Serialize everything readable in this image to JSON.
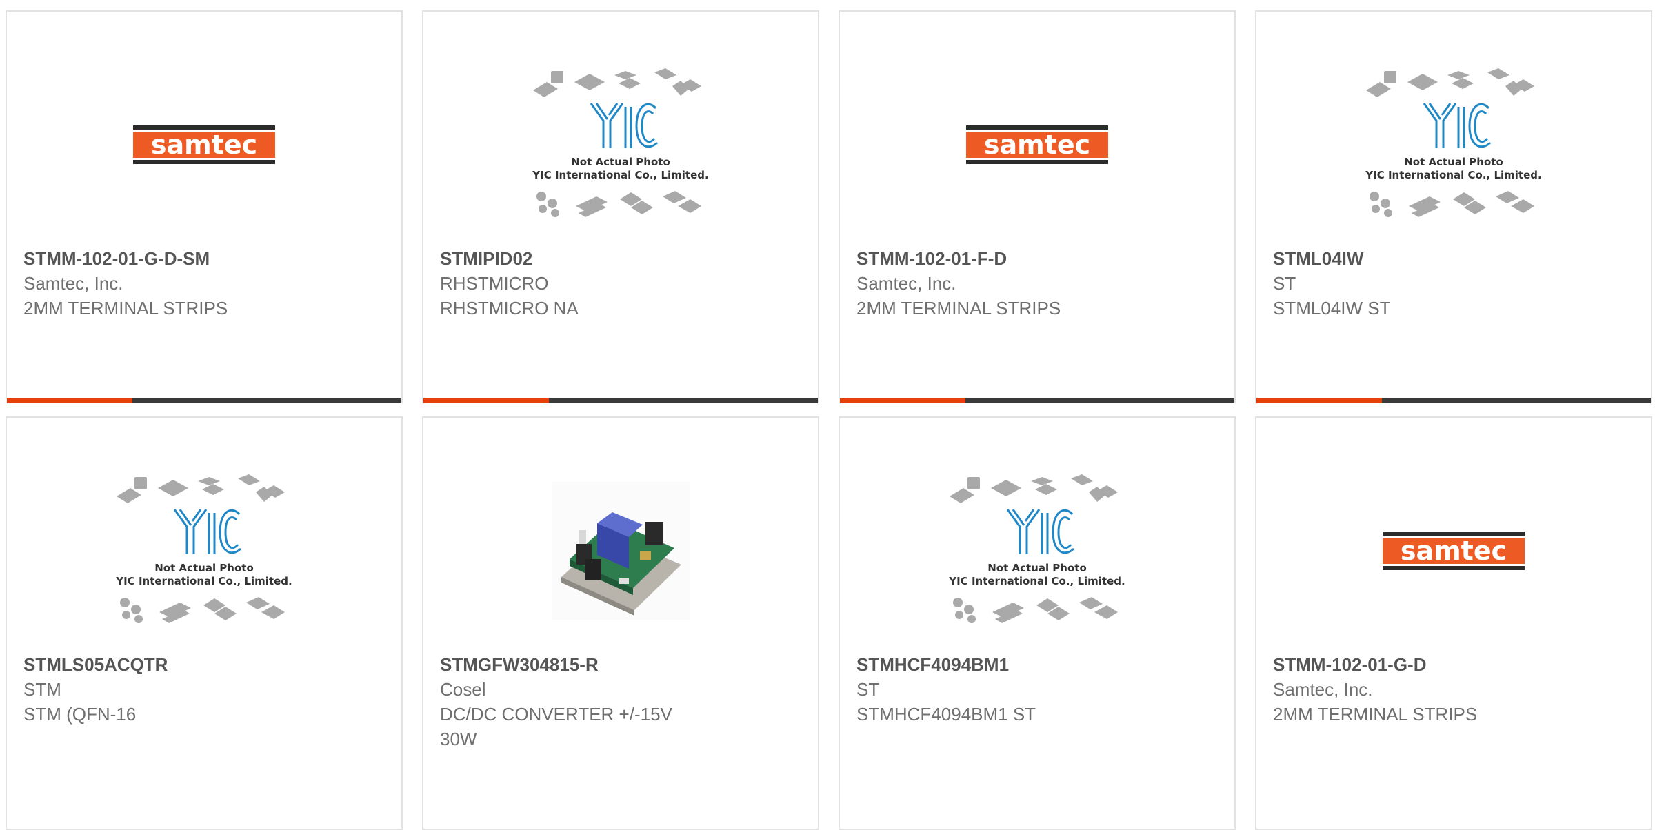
{
  "colors": {
    "accent": "#e8400c",
    "bar_dark": "#3a3a3a",
    "samtec_orange": "#ee5a24",
    "yic_blue": "#1e88c8"
  },
  "products": [
    {
      "part_number": "STMM-102-01-G-D-SM",
      "manufacturer": "Samtec, Inc.",
      "description": "2MM TERMINAL STRIPS",
      "image": "samtec-logo",
      "logo_text": "samtec"
    },
    {
      "part_number": "STMIPID02",
      "manufacturer": "RHSTMICRO",
      "description": "RHSTMICRO NA",
      "image": "yic-placeholder",
      "logo_text": "YIC",
      "note_line1": "Not Actual Photo",
      "note_line2": "YIC International Co., Limited."
    },
    {
      "part_number": "STMM-102-01-F-D",
      "manufacturer": "Samtec, Inc.",
      "description": "2MM TERMINAL STRIPS",
      "image": "samtec-logo",
      "logo_text": "samtec"
    },
    {
      "part_number": "STML04IW",
      "manufacturer": "ST",
      "description": "STML04IW ST",
      "image": "yic-placeholder",
      "logo_text": "YIC",
      "note_line1": "Not Actual Photo",
      "note_line2": "YIC International Co., Limited."
    },
    {
      "part_number": "STMLS05ACQTR",
      "manufacturer": "STM",
      "description": "STM (QFN-16",
      "image": "yic-placeholder",
      "logo_text": "YIC",
      "note_line1": "Not Actual Photo",
      "note_line2": "YIC International Co., Limited."
    },
    {
      "part_number": "STMGFW304815-R",
      "manufacturer": "Cosel",
      "description": "DC/DC CONVERTER +/-15V 30W",
      "image": "converter-photo"
    },
    {
      "part_number": "STMHCF4094BM1",
      "manufacturer": "ST",
      "description": "STMHCF4094BM1 ST",
      "image": "yic-placeholder",
      "logo_text": "YIC",
      "note_line1": "Not Actual Photo",
      "note_line2": "YIC International Co., Limited."
    },
    {
      "part_number": "STMM-102-01-G-D",
      "manufacturer": "Samtec, Inc.",
      "description": "2MM TERMINAL STRIPS",
      "image": "samtec-logo",
      "logo_text": "samtec"
    }
  ]
}
